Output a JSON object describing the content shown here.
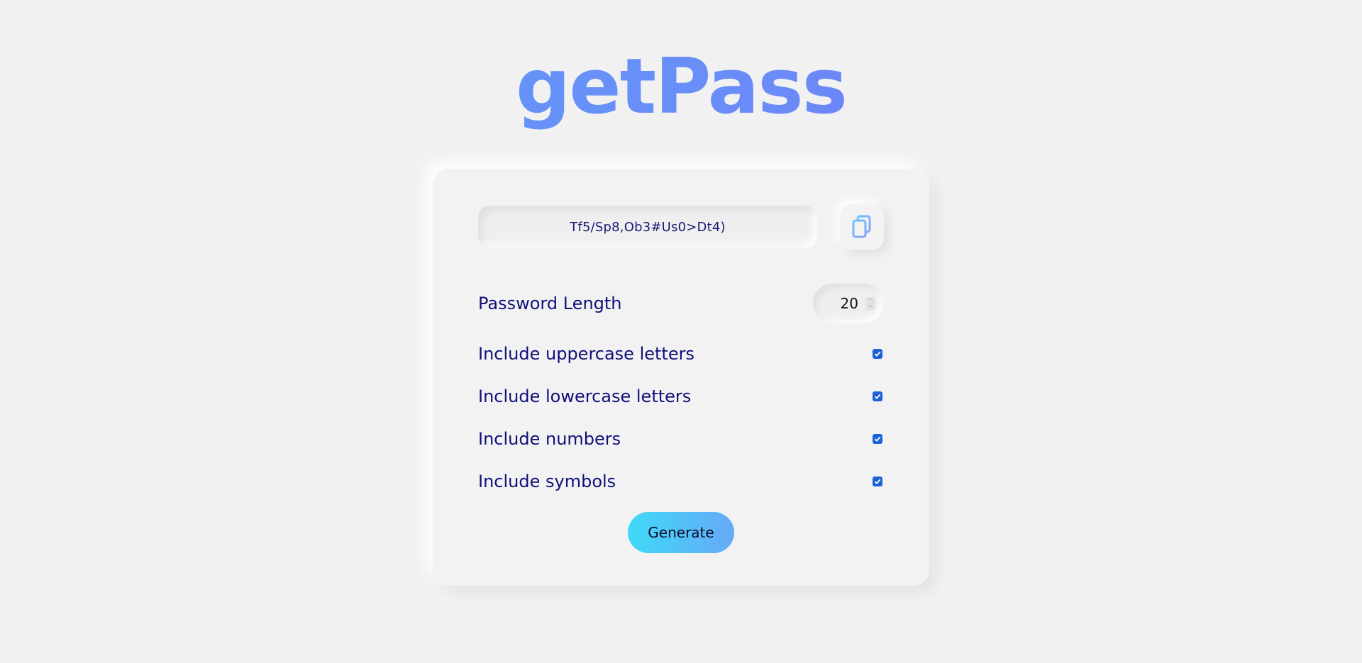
{
  "app": {
    "title": "getPass"
  },
  "password": {
    "value": "Tf5/Sp8,Ob3#Us0>Dt4)"
  },
  "copy_button": {
    "icon": "copy-icon"
  },
  "length": {
    "label": "Password Length",
    "value": "20"
  },
  "options": [
    {
      "label": "Include uppercase letters",
      "checked": true
    },
    {
      "label": "Include lowercase letters",
      "checked": true
    },
    {
      "label": "Include numbers",
      "checked": true
    },
    {
      "label": "Include symbols",
      "checked": true
    }
  ],
  "generate": {
    "label": "Generate"
  },
  "colors": {
    "background": "#f1f1f2",
    "label_text": "#10107a",
    "checkbox": "#1a62d6",
    "logo_gradient": [
      "#5aa2f8",
      "#7b6ef5"
    ],
    "button_gradient": [
      "#3fd9f7",
      "#66aaf7"
    ]
  }
}
